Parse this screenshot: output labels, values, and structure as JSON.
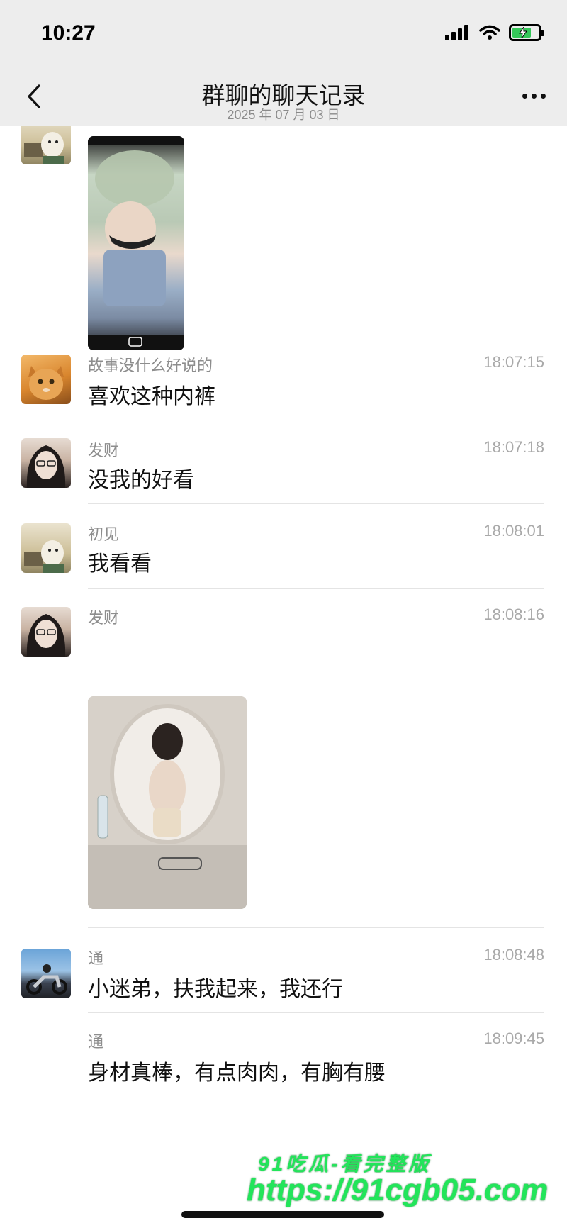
{
  "status_bar": {
    "time": "10:27"
  },
  "nav": {
    "title": "群聊的聊天记录",
    "subtitle": "2025 年 07 月 03 日"
  },
  "messages": [
    {
      "avatar": "cartoon-avatar",
      "sender": "",
      "time": "",
      "type": "image"
    },
    {
      "avatar": "cat-avatar",
      "sender": "故事没什么好说的",
      "time": "18:07:15",
      "text": "喜欢这种内裤"
    },
    {
      "avatar": "girl-avatar",
      "sender": "发财",
      "time": "18:07:18",
      "text": "没我的好看"
    },
    {
      "avatar": "cartoon-avatar",
      "sender": "初见",
      "time": "18:08:01",
      "text": "我看看"
    },
    {
      "avatar": "girl-avatar",
      "sender": "发财",
      "time": "18:08:16",
      "type": "image"
    },
    {
      "avatar": "motorcycle-avatar",
      "sender": "通",
      "time": "18:08:48",
      "text": "小迷弟，扶我起来，我还行"
    },
    {
      "avatar": "",
      "sender": "通",
      "time": "18:09:45",
      "text": "身材真棒，有点肉肉，有胸有腰"
    }
  ],
  "watermark": {
    "line1": "91吃瓜-看完整版",
    "line2": "https://91cgb05.com"
  },
  "colors": {
    "nav_bg": "#ededed",
    "watermark": "#22e55a",
    "battery": "#35c759"
  }
}
